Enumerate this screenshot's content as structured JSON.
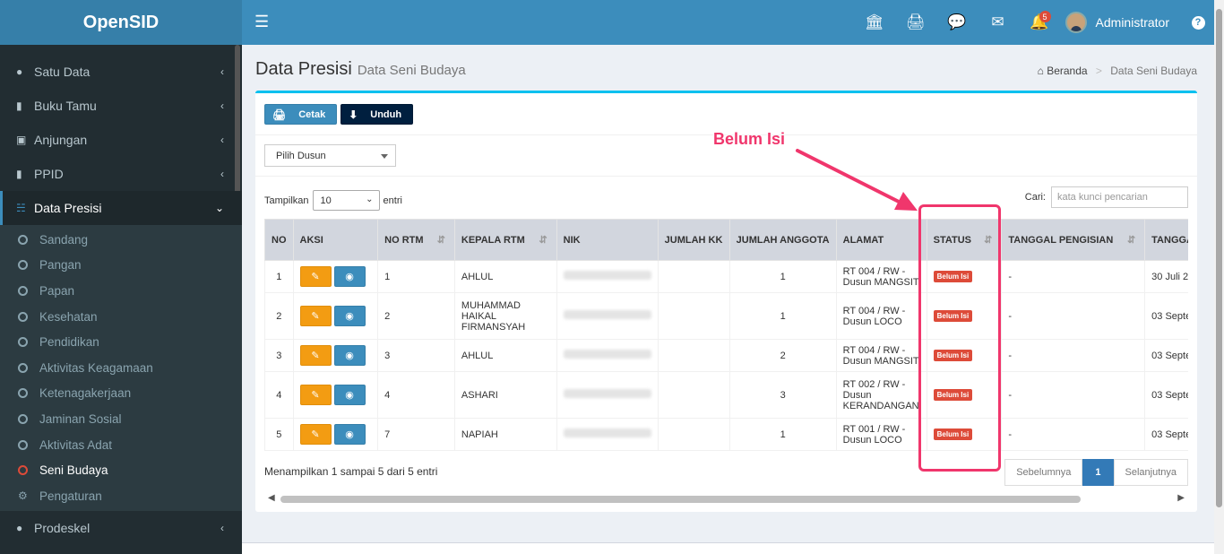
{
  "app": {
    "title": "OpenSID"
  },
  "topbar": {
    "notification_count": "5",
    "user_name": "Administrator"
  },
  "sidebar": {
    "items": [
      {
        "label": "Satu Data"
      },
      {
        "label": "Buku Tamu"
      },
      {
        "label": "Anjungan"
      },
      {
        "label": "PPID"
      },
      {
        "label": "Data Presisi"
      }
    ],
    "submenu": [
      {
        "label": "Sandang"
      },
      {
        "label": "Pangan"
      },
      {
        "label": "Papan"
      },
      {
        "label": "Kesehatan"
      },
      {
        "label": "Pendidikan"
      },
      {
        "label": "Aktivitas Keagamaan"
      },
      {
        "label": "Ketenagakerjaan"
      },
      {
        "label": "Jaminan Sosial"
      },
      {
        "label": "Aktivitas Adat"
      },
      {
        "label": "Seni Budaya"
      },
      {
        "label": "Pengaturan"
      }
    ],
    "last_item": {
      "label": "Prodeskel"
    }
  },
  "page": {
    "title": "Data Presisi",
    "subtitle": "Data Seni Budaya"
  },
  "breadcrumb": {
    "home": "Beranda",
    "current": "Data Seni Budaya"
  },
  "toolbar": {
    "print_label": "Cetak",
    "download_label": "Unduh"
  },
  "filter": {
    "dusun_placeholder": "Pilih Dusun"
  },
  "datatable": {
    "show_label": "Tampilkan",
    "length_value": "10",
    "entries_label": "entri",
    "search_label": "Cari:",
    "search_placeholder": "kata kunci pencarian",
    "info": "Menampilkan 1 sampai 5 dari 5 entri",
    "prev_label": "Sebelumnya",
    "current_page": "1",
    "next_label": "Selanjutnya"
  },
  "table": {
    "headers": [
      "NO",
      "AKSI",
      "NO RTM",
      "KEPALA RTM",
      "NIK",
      "JUMLAH KK",
      "JUMLAH ANGGOTA",
      "ALAMAT",
      "STATUS",
      "TANGGAL PENGISIAN",
      "TANGGA"
    ],
    "rows": [
      {
        "no": "1",
        "no_rtm": "1",
        "kepala": "AHLUL",
        "jumlah_kk": "",
        "anggota": "1",
        "alamat": "RT 004 / RW - Dusun MANGSIT",
        "status": "Belum Isi",
        "tgl_isi": "-",
        "tgl2": "30 Juli 2"
      },
      {
        "no": "2",
        "no_rtm": "2",
        "kepala": "MUHAMMAD HAIKAL FIRMANSYAH",
        "jumlah_kk": "",
        "anggota": "1",
        "alamat": "RT 004 / RW - Dusun LOCO",
        "status": "Belum Isi",
        "tgl_isi": "-",
        "tgl2": "03 Septe"
      },
      {
        "no": "3",
        "no_rtm": "3",
        "kepala": "AHLUL",
        "jumlah_kk": "",
        "anggota": "2",
        "alamat": "RT 004 / RW - Dusun MANGSIT",
        "status": "Belum Isi",
        "tgl_isi": "-",
        "tgl2": "03 Septe"
      },
      {
        "no": "4",
        "no_rtm": "4",
        "kepala": "ASHARI",
        "jumlah_kk": "",
        "anggota": "3",
        "alamat": "RT 002 / RW - Dusun KERANDANGAN",
        "status": "Belum Isi",
        "tgl_isi": "-",
        "tgl2": "03 Septe"
      },
      {
        "no": "5",
        "no_rtm": "7",
        "kepala": "NAPIAH",
        "jumlah_kk": "",
        "anggota": "1",
        "alamat": "RT 001 / RW - Dusun LOCO",
        "status": "Belum Isi",
        "tgl_isi": "-",
        "tgl2": "03 Septe"
      }
    ]
  },
  "annotation": {
    "label": "Belum Isi",
    "color": "#f0366c"
  },
  "icons": {
    "menu": "hamburger-icon",
    "bank": "bank-icon",
    "print": "print-icon",
    "chat": "chat-icon",
    "mail": "mail-icon",
    "bell": "bell-icon",
    "help": "help-icon"
  }
}
